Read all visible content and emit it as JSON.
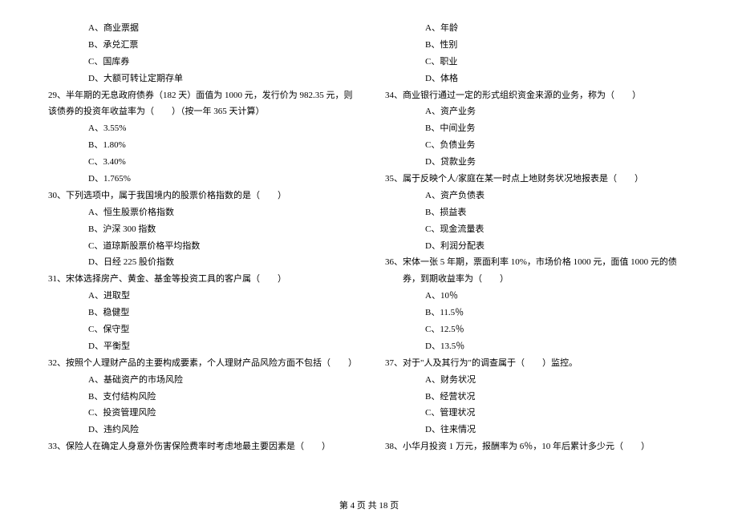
{
  "col1": {
    "q28_options": {
      "a": "A、商业票据",
      "b": "B、承兑汇票",
      "c": "C、国库券",
      "d": "D、大额可转让定期存单"
    },
    "q29": {
      "text": "29、半年期的无息政府债券（182 天）面值为 1000 元，发行价为 982.35 元，则该债券的投资年收益率为（　　）（按一年 365 天计算）",
      "a": "A、3.55%",
      "b": "B、1.80%",
      "c": "C、3.40%",
      "d": "D、1.765%"
    },
    "q30": {
      "text": "30、下列选项中，属于我国境内的股票价格指数的是（　　）",
      "a": "A、恒生股票价格指数",
      "b": "B、沪深 300 指数",
      "c": "C、道琼斯股票价格平均指数",
      "d": "D、日经 225 股价指数"
    },
    "q31": {
      "text": "31、宋体选择房产、黄金、基金等投资工具的客户属（　　）",
      "a": "A、进取型",
      "b": "B、稳健型",
      "c": "C、保守型",
      "d": "D、平衡型"
    },
    "q32": {
      "text": "32、按照个人理财产品的主要构成要素，个人理财产品风险方面不包括（　　）",
      "a": "A、基础资产的市场风险",
      "b": "B、支付结构风险",
      "c": "C、投资管理风险",
      "d": "D、违约风险"
    },
    "q33": {
      "text": "33、保险人在确定人身意外伤害保险费率时考虑地最主要因素是（　　）"
    }
  },
  "col2": {
    "q33_options": {
      "a": "A、年龄",
      "b": "B、性别",
      "c": "C、职业",
      "d": "D、体格"
    },
    "q34": {
      "text": "34、商业银行通过一定的形式组织资金来源的业务，称为（　　）",
      "a": "A、资产业务",
      "b": "B、中间业务",
      "c": "C、负债业务",
      "d": "D、贷款业务"
    },
    "q35": {
      "text": "35、属于反映个人/家庭在某一时点上地财务状况地报表是（　　）",
      "a": "A、资产负债表",
      "b": "B、损益表",
      "c": "C、现金流量表",
      "d": "D、利润分配表"
    },
    "q36": {
      "text": "36、宋体一张 5 年期，票面利率 10%，市场价格 1000 元，面值 1000 元的债券，到期收益率为（　　）",
      "a": "A、10％",
      "b": "B、11.5％",
      "c": "C、12.5％",
      "d": "D、13.5％"
    },
    "q37": {
      "text": "37、对于\"人及其行为\"的调查属于（　　）监控。",
      "a": "A、财务状况",
      "b": "B、经营状况",
      "c": "C、管理状况",
      "d": "D、往来情况"
    },
    "q38": {
      "text": "38、小华月投资 1 万元，报酬率为 6％，10 年后累计多少元（　　）"
    }
  },
  "footer": "第 4 页 共 18 页"
}
